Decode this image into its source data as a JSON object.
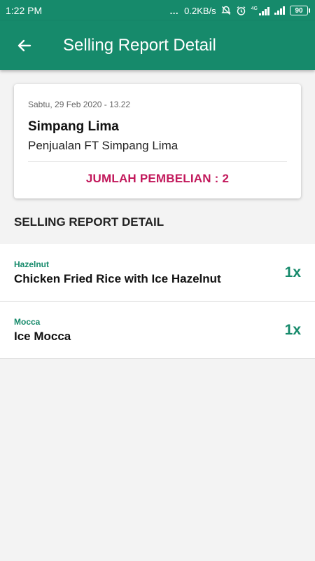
{
  "status_bar": {
    "time": "1:22 PM",
    "net_speed": "0.2KB/s",
    "network_type": "4G",
    "battery": "90"
  },
  "app_bar": {
    "title": "Selling Report Detail",
    "back_icon": "arrow-left-icon"
  },
  "summary_card": {
    "date": "Sabtu, 29 Feb 2020 - 13.22",
    "title": "Simpang Lima",
    "subtitle": "Penjualan FT Simpang Lima",
    "total_label": "JUMLAH PEMBELIAN : 2"
  },
  "section_title": "SELLING REPORT DETAIL",
  "items": [
    {
      "category": "Hazelnut",
      "name": "Chicken Fried Rice with Ice Hazelnut",
      "qty": "1x"
    },
    {
      "category": "Mocca",
      "name": "Ice Mocca",
      "qty": "1x"
    }
  ],
  "colors": {
    "primary": "#168a6b",
    "accent": "#c2185b",
    "background": "#f3f3f3"
  }
}
